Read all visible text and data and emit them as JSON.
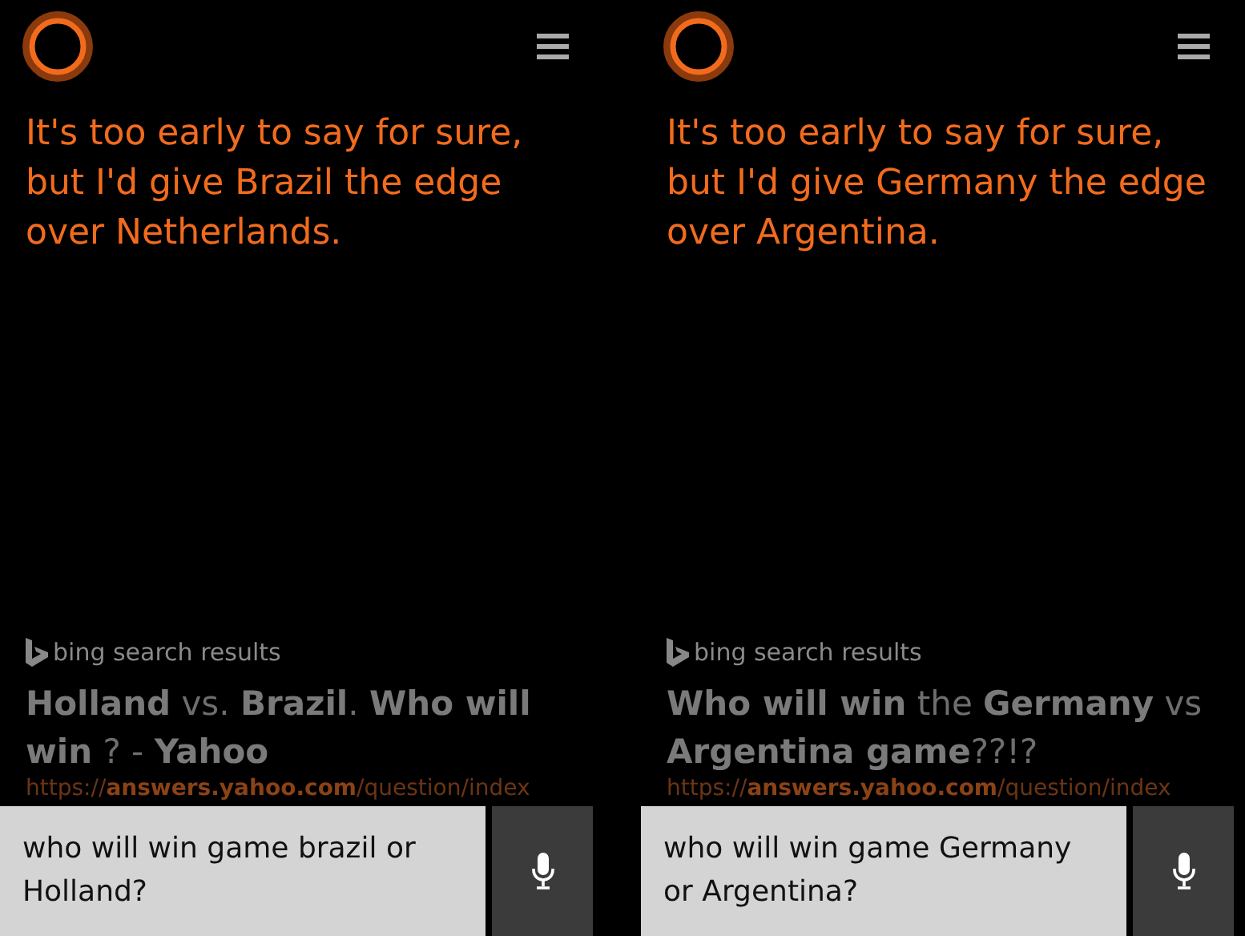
{
  "panels": [
    {
      "answer": "It's too early to say for sure, but I'd give Brazil the edge over Netherlands.",
      "results_source": "bing search results",
      "result_title": "**Holland** vs. **Brazil**. **Who will win** ? - **Yahoo**",
      "result_url": "https://**answers.yahoo.com**/question/index",
      "query": "who will win game brazil or Holland?"
    },
    {
      "answer": "It's too early to say for sure, but I'd give Germany the edge over Argentina.",
      "results_source": "bing search results",
      "result_title": "**Who will win** the **Germany** vs **Argentina game**??!?",
      "result_url": "https://**answers.yahoo.com**/question/index",
      "query": "who will win game Germany or Argentina?"
    }
  ]
}
